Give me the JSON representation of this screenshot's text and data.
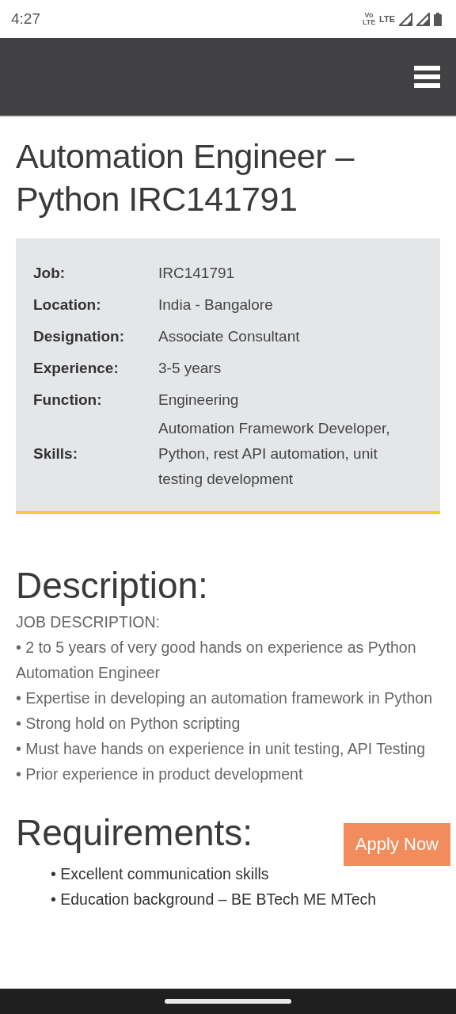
{
  "status_bar": {
    "time": "4:27",
    "volte": "Vo LTE",
    "network": "LTE"
  },
  "title": "Automation Engineer – Python IRC141791",
  "details": [
    {
      "label": "Job:",
      "value": "IRC141791"
    },
    {
      "label": "Location:",
      "value": "India - Bangalore"
    },
    {
      "label": "Designation:",
      "value": "Associate Consultant"
    },
    {
      "label": "Experience:",
      "value": "3-5 years"
    },
    {
      "label": "Function:",
      "value": "Engineering"
    },
    {
      "label": "Skills:",
      "value": "Automation Framework Developer, Python, rest API automation, unit testing development"
    }
  ],
  "description": {
    "heading": "Description:",
    "intro": "JOB DESCRIPTION:",
    "items": [
      "• 2 to 5 years of very good hands on experience as Python Automation Engineer",
      "• Expertise in developing an automation framework in Python",
      "• Strong hold on Python scripting",
      "• Must have hands on experience in unit testing, API Testing",
      "• Prior experience in product development"
    ]
  },
  "requirements": {
    "heading": "Requirements:",
    "items": [
      "• Excellent communication skills",
      "• Education background – BE BTech ME MTech"
    ]
  },
  "apply_button": "Apply Now"
}
